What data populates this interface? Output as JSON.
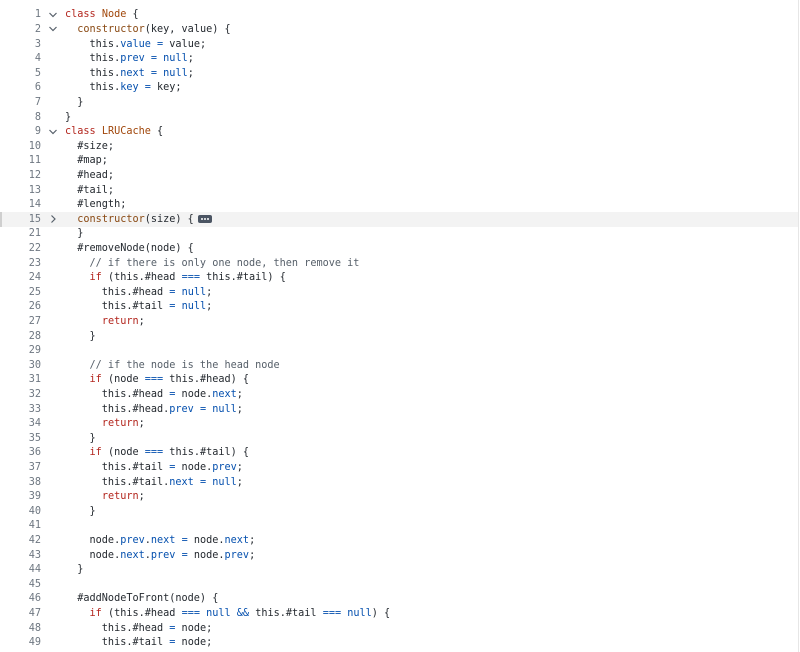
{
  "editor": {
    "collapsed_line": "15",
    "lines": [
      {
        "n": "1",
        "fold": "open",
        "t": [
          [
            "kw",
            "class"
          ],
          [
            "",
            "​ "
          ],
          [
            "cls",
            "Node"
          ],
          [
            "",
            " {"
          ]
        ]
      },
      {
        "n": "2",
        "fold": "open",
        "t": [
          [
            "",
            "  "
          ],
          [
            "ent",
            "constructor"
          ],
          [
            "",
            "(key, value) {"
          ]
        ]
      },
      {
        "n": "3",
        "t": [
          [
            "",
            "    this."
          ],
          [
            "pr",
            "value"
          ],
          [
            "",
            " "
          ],
          [
            "op",
            "="
          ],
          [
            "",
            " value;"
          ]
        ]
      },
      {
        "n": "4",
        "t": [
          [
            "",
            "    this."
          ],
          [
            "pr",
            "prev"
          ],
          [
            "",
            " "
          ],
          [
            "op",
            "="
          ],
          [
            "",
            " "
          ],
          [
            "nl",
            "null"
          ],
          [
            "",
            ";"
          ]
        ]
      },
      {
        "n": "5",
        "t": [
          [
            "",
            "    this."
          ],
          [
            "pr",
            "next"
          ],
          [
            "",
            " "
          ],
          [
            "op",
            "="
          ],
          [
            "",
            " "
          ],
          [
            "nl",
            "null"
          ],
          [
            "",
            ";"
          ]
        ]
      },
      {
        "n": "6",
        "t": [
          [
            "",
            "    this."
          ],
          [
            "pr",
            "key"
          ],
          [
            "",
            " "
          ],
          [
            "op",
            "="
          ],
          [
            "",
            " key;"
          ]
        ]
      },
      {
        "n": "7",
        "t": [
          [
            "",
            "  }"
          ]
        ]
      },
      {
        "n": "8",
        "t": [
          [
            "",
            "}"
          ]
        ]
      },
      {
        "n": "9",
        "fold": "open",
        "t": [
          [
            "kw",
            "class"
          ],
          [
            "",
            " "
          ],
          [
            "cls",
            "LRUCache"
          ],
          [
            "",
            " {"
          ]
        ]
      },
      {
        "n": "10",
        "t": [
          [
            "",
            "  #size;"
          ]
        ]
      },
      {
        "n": "11",
        "t": [
          [
            "",
            "  #map;"
          ]
        ]
      },
      {
        "n": "12",
        "t": [
          [
            "",
            "  #head;"
          ]
        ]
      },
      {
        "n": "13",
        "t": [
          [
            "",
            "  #tail;"
          ]
        ]
      },
      {
        "n": "14",
        "t": [
          [
            "",
            "  #length;"
          ]
        ]
      },
      {
        "n": "15",
        "fold": "closed",
        "collapsed": true,
        "t": [
          [
            "",
            "  "
          ],
          [
            "ent",
            "constructor"
          ],
          [
            "",
            "(size) {"
          ]
        ]
      },
      {
        "n": "21",
        "t": [
          [
            "",
            "  }"
          ]
        ]
      },
      {
        "n": "22",
        "t": [
          [
            "",
            "  #removeNode(node) {"
          ]
        ]
      },
      {
        "n": "23",
        "t": [
          [
            "cm",
            "    // if there is only one node, then remove it"
          ]
        ]
      },
      {
        "n": "24",
        "t": [
          [
            "",
            "    "
          ],
          [
            "kw",
            "if"
          ],
          [
            "",
            " (this.#head "
          ],
          [
            "op",
            "==="
          ],
          [
            "",
            " this.#tail) {"
          ]
        ]
      },
      {
        "n": "25",
        "t": [
          [
            "",
            "      this.#head "
          ],
          [
            "op",
            "="
          ],
          [
            "",
            " "
          ],
          [
            "nl",
            "null"
          ],
          [
            "",
            ";"
          ]
        ]
      },
      {
        "n": "26",
        "t": [
          [
            "",
            "      this.#tail "
          ],
          [
            "op",
            "="
          ],
          [
            "",
            " "
          ],
          [
            "nl",
            "null"
          ],
          [
            "",
            ";"
          ]
        ]
      },
      {
        "n": "27",
        "t": [
          [
            "",
            "      "
          ],
          [
            "kw",
            "return"
          ],
          [
            "",
            ";"
          ]
        ]
      },
      {
        "n": "28",
        "t": [
          [
            "",
            "    }"
          ]
        ]
      },
      {
        "n": "29",
        "t": []
      },
      {
        "n": "30",
        "t": [
          [
            "cm",
            "    // if the node is the head node"
          ]
        ]
      },
      {
        "n": "31",
        "t": [
          [
            "",
            "    "
          ],
          [
            "kw",
            "if"
          ],
          [
            "",
            " (node "
          ],
          [
            "op",
            "==="
          ],
          [
            "",
            " this.#head) {"
          ]
        ]
      },
      {
        "n": "32",
        "t": [
          [
            "",
            "      this.#head "
          ],
          [
            "op",
            "="
          ],
          [
            "",
            " node."
          ],
          [
            "pr",
            "next"
          ],
          [
            "",
            ";"
          ]
        ]
      },
      {
        "n": "33",
        "t": [
          [
            "",
            "      this.#head."
          ],
          [
            "pr",
            "prev"
          ],
          [
            "",
            " "
          ],
          [
            "op",
            "="
          ],
          [
            "",
            " "
          ],
          [
            "nl",
            "null"
          ],
          [
            "",
            ";"
          ]
        ]
      },
      {
        "n": "34",
        "t": [
          [
            "",
            "      "
          ],
          [
            "kw",
            "return"
          ],
          [
            "",
            ";"
          ]
        ]
      },
      {
        "n": "35",
        "t": [
          [
            "",
            "    }"
          ]
        ]
      },
      {
        "n": "36",
        "t": [
          [
            "",
            "    "
          ],
          [
            "kw",
            "if"
          ],
          [
            "",
            " (node "
          ],
          [
            "op",
            "==="
          ],
          [
            "",
            " this.#tail) {"
          ]
        ]
      },
      {
        "n": "37",
        "t": [
          [
            "",
            "      this.#tail "
          ],
          [
            "op",
            "="
          ],
          [
            "",
            " node."
          ],
          [
            "pr",
            "prev"
          ],
          [
            "",
            ";"
          ]
        ]
      },
      {
        "n": "38",
        "t": [
          [
            "",
            "      this.#tail."
          ],
          [
            "pr",
            "next"
          ],
          [
            "",
            " "
          ],
          [
            "op",
            "="
          ],
          [
            "",
            " "
          ],
          [
            "nl",
            "null"
          ],
          [
            "",
            ";"
          ]
        ]
      },
      {
        "n": "39",
        "t": [
          [
            "",
            "      "
          ],
          [
            "kw",
            "return"
          ],
          [
            "",
            ";"
          ]
        ]
      },
      {
        "n": "40",
        "t": [
          [
            "",
            "    }"
          ]
        ]
      },
      {
        "n": "41",
        "t": []
      },
      {
        "n": "42",
        "t": [
          [
            "",
            "    node."
          ],
          [
            "pr",
            "prev"
          ],
          [
            "",
            "."
          ],
          [
            "pr",
            "next"
          ],
          [
            "",
            " "
          ],
          [
            "op",
            "="
          ],
          [
            "",
            " node."
          ],
          [
            "pr",
            "next"
          ],
          [
            "",
            ";"
          ]
        ]
      },
      {
        "n": "43",
        "t": [
          [
            "",
            "    node."
          ],
          [
            "pr",
            "next"
          ],
          [
            "",
            "."
          ],
          [
            "pr",
            "prev"
          ],
          [
            "",
            " "
          ],
          [
            "op",
            "="
          ],
          [
            "",
            " node."
          ],
          [
            "pr",
            "prev"
          ],
          [
            "",
            ";"
          ]
        ]
      },
      {
        "n": "44",
        "t": [
          [
            "",
            "  }"
          ]
        ]
      },
      {
        "n": "45",
        "t": []
      },
      {
        "n": "46",
        "t": [
          [
            "",
            "  #addNodeToFront(node) {"
          ]
        ]
      },
      {
        "n": "47",
        "t": [
          [
            "",
            "    "
          ],
          [
            "kw",
            "if"
          ],
          [
            "",
            " (this.#head "
          ],
          [
            "op",
            "==="
          ],
          [
            "",
            " "
          ],
          [
            "nl",
            "null"
          ],
          [
            "",
            " "
          ],
          [
            "op",
            "&&"
          ],
          [
            "",
            " this.#tail "
          ],
          [
            "op",
            "==="
          ],
          [
            "",
            " "
          ],
          [
            "nl",
            "null"
          ],
          [
            "",
            ") {"
          ]
        ]
      },
      {
        "n": "48",
        "t": [
          [
            "",
            "      this.#head "
          ],
          [
            "op",
            "="
          ],
          [
            "",
            " node;"
          ]
        ]
      },
      {
        "n": "49",
        "t": [
          [
            "",
            "      this.#tail "
          ],
          [
            "op",
            "="
          ],
          [
            "",
            " node;"
          ]
        ]
      }
    ]
  }
}
